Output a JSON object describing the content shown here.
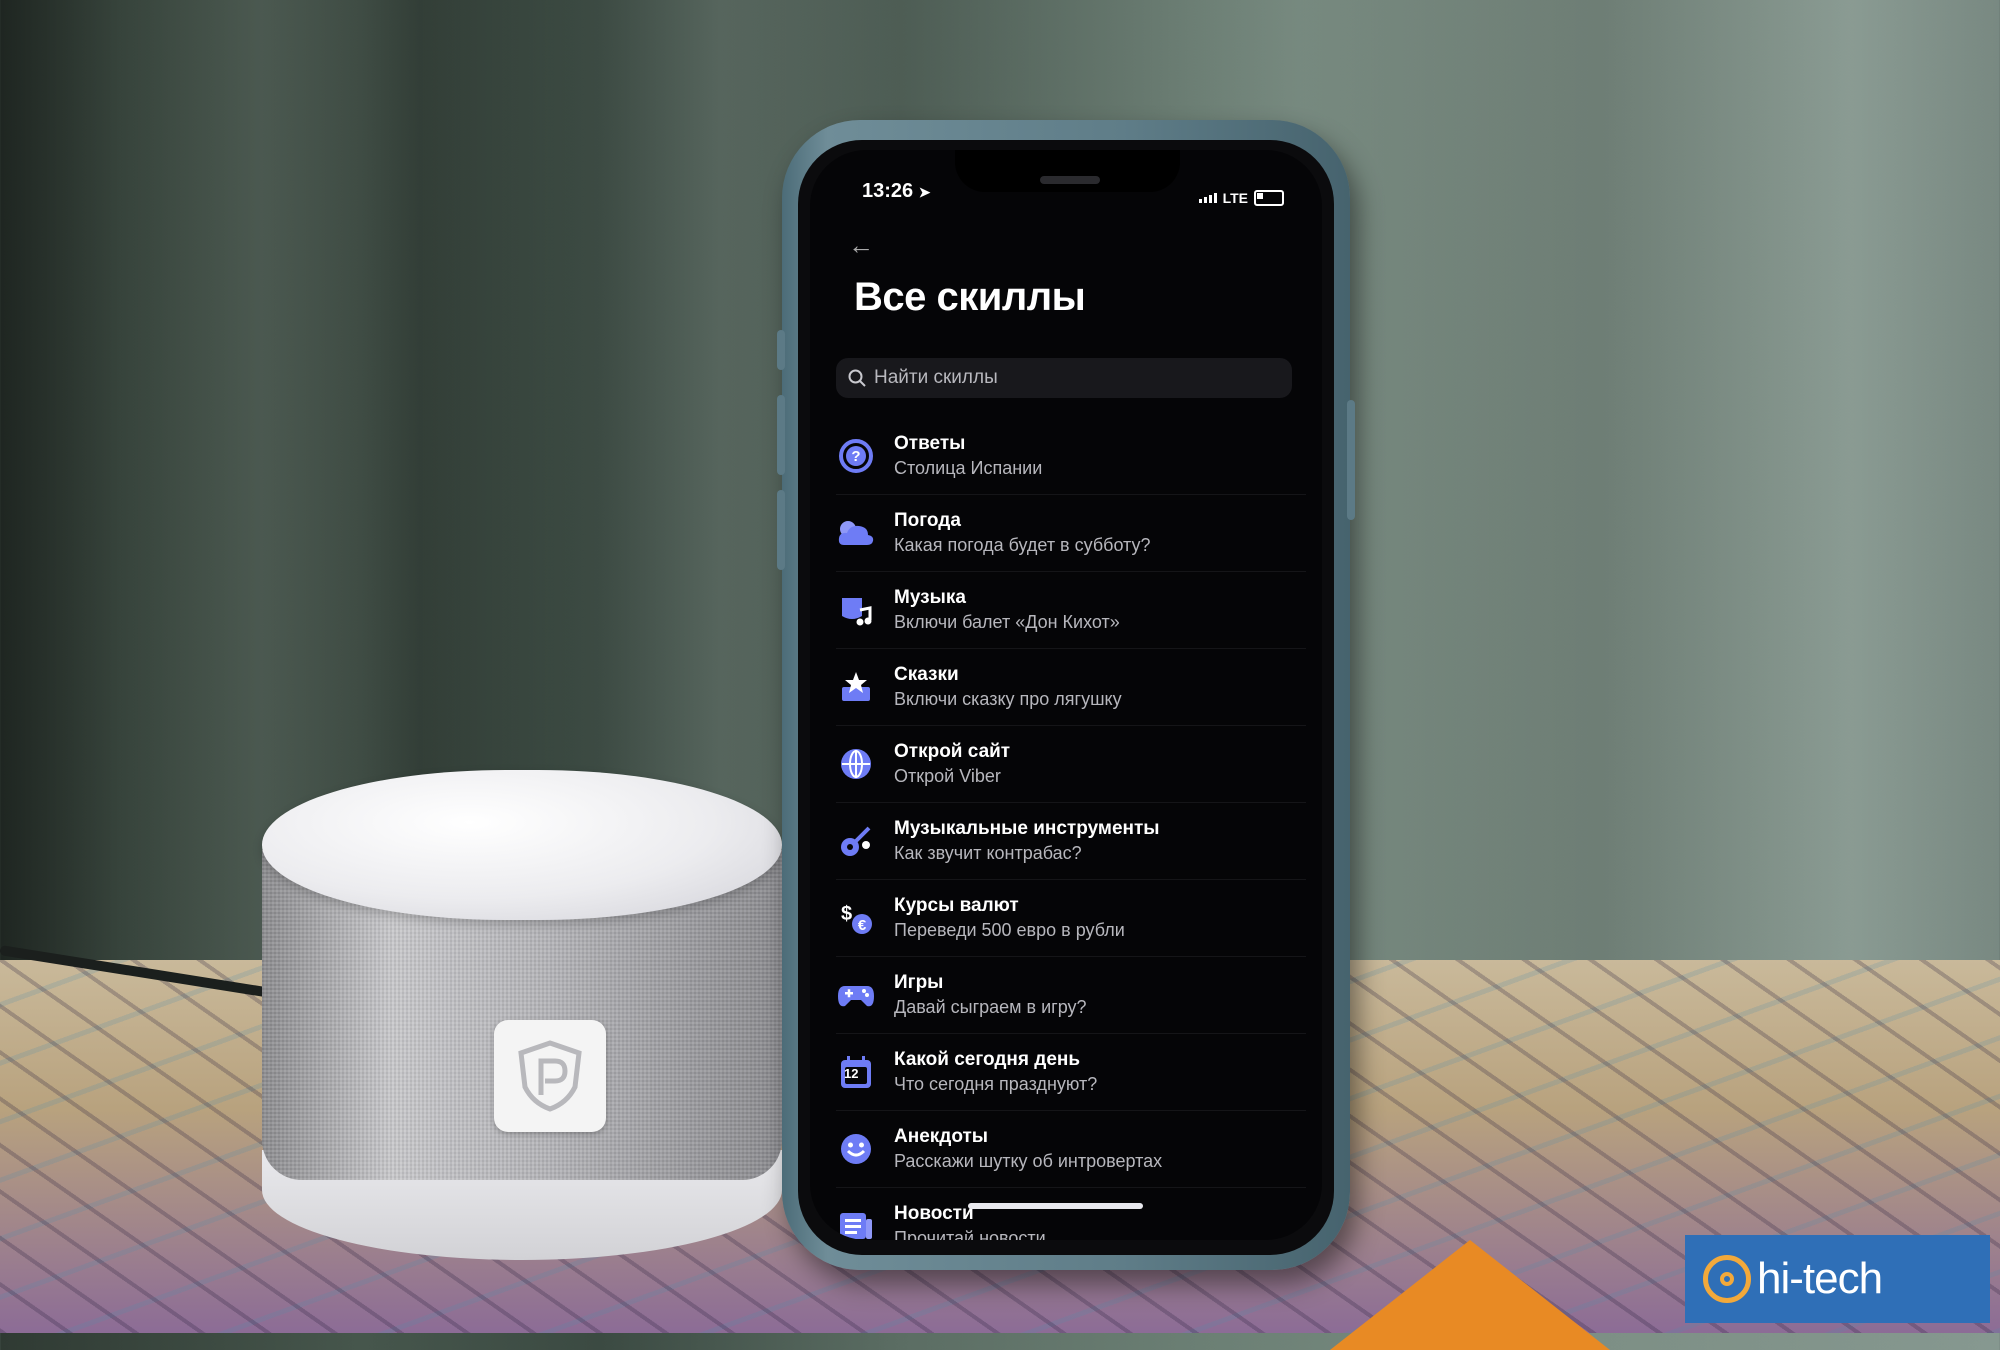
{
  "status": {
    "time": "13:26",
    "network": "LTE"
  },
  "header": {
    "title": "Все скиллы"
  },
  "search": {
    "placeholder": "Найти скиллы"
  },
  "skills": [
    {
      "title": "Ответы",
      "subtitle": "Столица Испании",
      "icon": "question-icon"
    },
    {
      "title": "Погода",
      "subtitle": "Какая погода будет в субботу?",
      "icon": "cloud-icon"
    },
    {
      "title": "Музыка",
      "subtitle": "Включи балет «Дон Кихот»",
      "icon": "music-icon"
    },
    {
      "title": "Сказки",
      "subtitle": "Включи сказку про лягушку",
      "icon": "fairy-tale-icon"
    },
    {
      "title": "Открой сайт",
      "subtitle": "Открой Viber",
      "icon": "globe-icon"
    },
    {
      "title": "Музыкальные инструменты",
      "subtitle": "Как звучит контрабас?",
      "icon": "guitar-icon"
    },
    {
      "title": "Курсы валют",
      "subtitle": "Переведи 500 евро в рубли",
      "icon": "currency-icon"
    },
    {
      "title": "Игры",
      "subtitle": "Давай сыграем в игру?",
      "icon": "gamepad-icon"
    },
    {
      "title": "Какой сегодня день",
      "subtitle": "Что сегодня празднуют?",
      "icon": "calendar-icon",
      "calendar_number": "12"
    },
    {
      "title": "Анекдоты",
      "subtitle": "Расскажи шутку об интровертах",
      "icon": "smile-icon"
    },
    {
      "title": "Новости",
      "subtitle": "Прочитай новости",
      "icon": "news-icon"
    }
  ],
  "watermark": {
    "text": "hi-tech"
  },
  "colors": {
    "accent": "#5b6cf2",
    "watermark_bg": "#2f6fb7",
    "watermark_accent": "#f2a93b"
  }
}
